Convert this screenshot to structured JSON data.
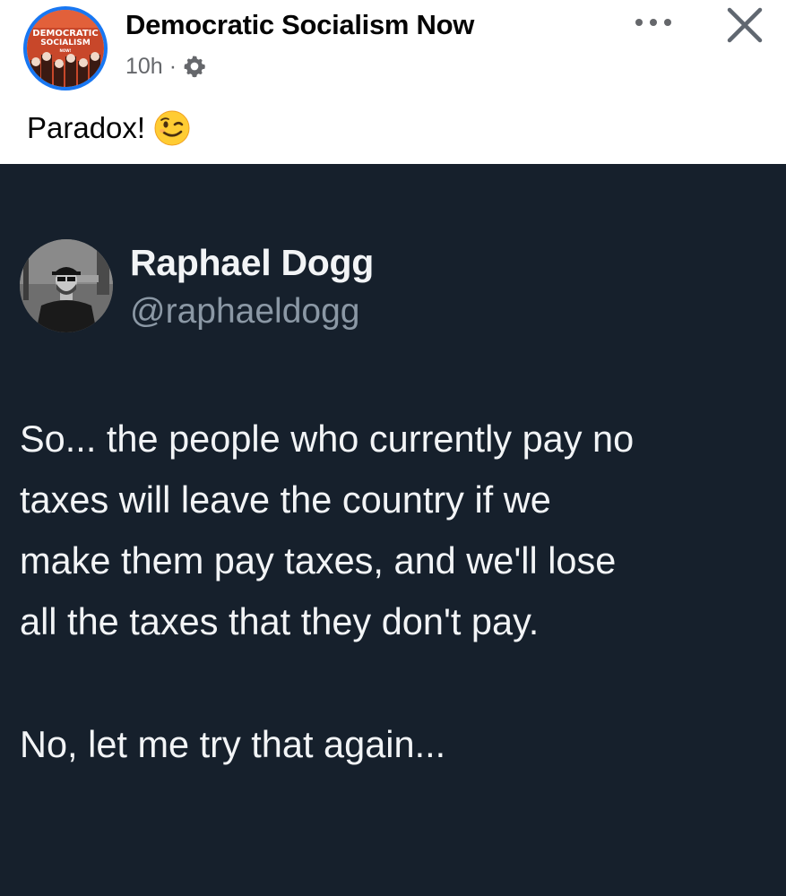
{
  "post": {
    "page_name": "Democratic Socialism Now",
    "timestamp": "10h",
    "separator": "·",
    "caption": "Paradox!",
    "caption_emoji": "wink-emoji",
    "privacy_icon": "gear-icon",
    "more_icon": "more-horizontal-icon",
    "close_icon": "close-icon"
  },
  "page_logo": {
    "line1": "DEMOCRATIC",
    "line2": "SOCIALISM",
    "line3": "NOW!"
  },
  "tweet": {
    "display_name": "Raphael Dogg",
    "handle": "@raphaeldogg",
    "lines": [
      "So... the people who currently pay no",
      "taxes will leave the country if we",
      "make them pay taxes, and we'll lose",
      "all the taxes that they don't pay.",
      "No, let me try that again..."
    ]
  },
  "colors": {
    "fb_blue": "#1877f2",
    "tweet_background": "#16202c",
    "tweet_text": "#f2f4f6",
    "tweet_secondary": "#8b98a5",
    "fb_secondary": "#65676b"
  }
}
